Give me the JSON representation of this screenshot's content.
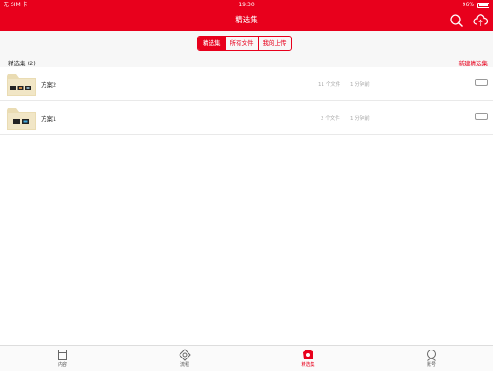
{
  "status": {
    "carrier": "无 SIM 卡",
    "time": "19:30",
    "battery": "96%"
  },
  "header": {
    "title": "精选集"
  },
  "segments": [
    "精选集",
    "所有文件",
    "我的上传"
  ],
  "list_header": {
    "label": "精选集 (2)",
    "new_label": "新建精选集"
  },
  "rows": [
    {
      "name": "方案2",
      "count": "11 个文件",
      "time": "1 分钟前"
    },
    {
      "name": "方案1",
      "count": "2 个文件",
      "time": "1 分钟前"
    }
  ],
  "more_label": "···",
  "tabs": [
    "内容",
    "流程",
    "精选集",
    "账号"
  ],
  "colors": {
    "accent": "#e8001c"
  }
}
